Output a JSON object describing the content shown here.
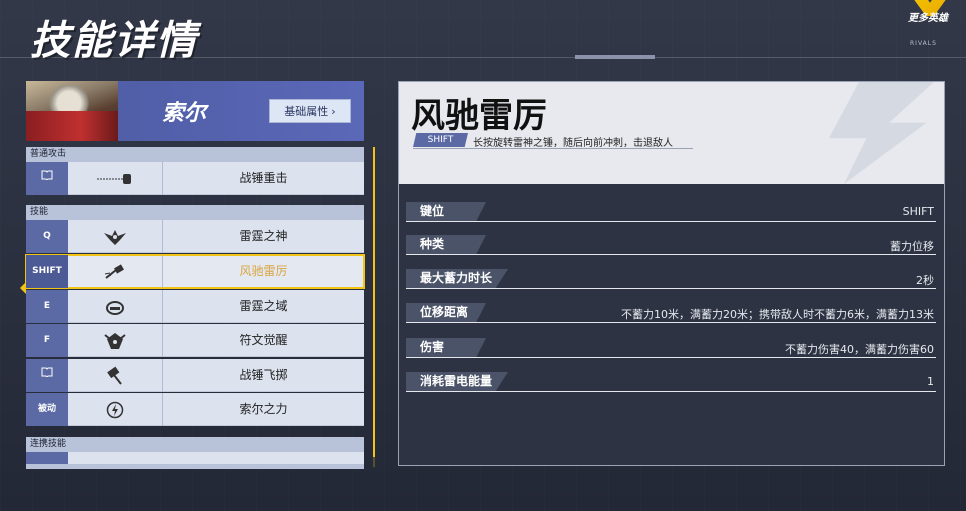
{
  "page": {
    "title": "技能详情",
    "logo_text": "更多英雄",
    "logo_sub": "RIVALS"
  },
  "hero": {
    "name": "索尔",
    "attr_button": "基础属性",
    "attr_button_chevron": "›"
  },
  "sections": {
    "normal": "普通攻击",
    "skills": "技能",
    "team": "连携技能"
  },
  "normal_attack": {
    "key_icon": "book-icon",
    "icon": "hammer-dash-icon",
    "name": "战锤重击"
  },
  "skills": [
    {
      "key": "Q",
      "icon": "winged-hammer-icon",
      "name": "雷霆之神"
    },
    {
      "key": "SHIFT",
      "icon": "hammer-throw-icon",
      "name": "风驰雷厉",
      "active": true
    },
    {
      "key": "E",
      "icon": "helmet-icon",
      "name": "雷霆之域"
    },
    {
      "key": "F",
      "icon": "rune-icon",
      "name": "符文觉醒"
    },
    {
      "key_icon": "book-icon",
      "icon": "hammer-fly-icon",
      "name": "战锤飞掷"
    },
    {
      "key": "被动",
      "icon": "lightning-circle-icon",
      "name": "索尔之力"
    }
  ],
  "detail": {
    "title": "风驰雷厉",
    "key": "SHIFT",
    "description": "长按旋转雷神之锤，随后向前冲刺，击退敌人",
    "attributes": [
      {
        "label": "键位",
        "value": "SHIFT"
      },
      {
        "label": "种类",
        "value": "蓄力位移"
      },
      {
        "label": "最大蓄力时长",
        "value": "2秒"
      },
      {
        "label": "位移距离",
        "value": "不蓄力10米，满蓄力20米；携带敌人时不蓄力6米，满蓄力13米"
      },
      {
        "label": "伤害",
        "value": "不蓄力伤害40，满蓄力伤害60"
      },
      {
        "label": "消耗雷电能量",
        "value": "1"
      }
    ]
  },
  "colors": {
    "accent_yellow": "#f2c415",
    "key_blue": "#5b6aa4",
    "active_text": "#d9a642"
  }
}
